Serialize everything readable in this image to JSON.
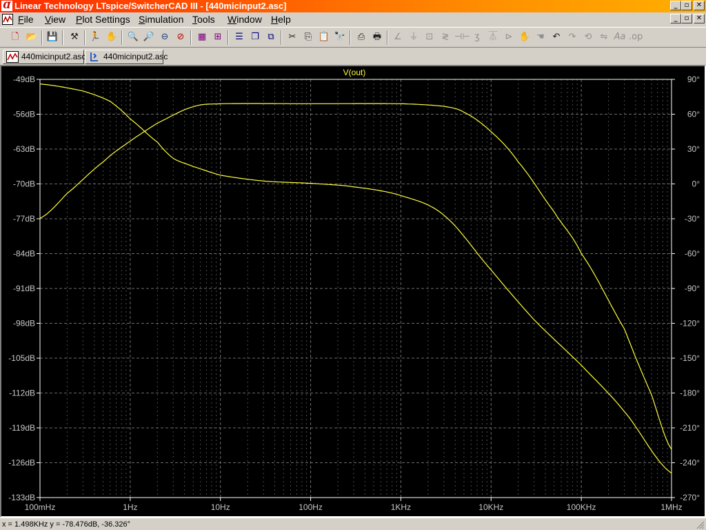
{
  "window": {
    "title": "Linear Technology LTspice/SwitcherCAD III - [440micinput2.asc]",
    "controls": [
      "_",
      "▫",
      "✕"
    ]
  },
  "menu": {
    "items": [
      {
        "label": "File",
        "accel": "F"
      },
      {
        "label": "View",
        "accel": "V"
      },
      {
        "label": "Plot Settings",
        "accel": "P"
      },
      {
        "label": "Simulation",
        "accel": "S"
      },
      {
        "label": "Tools",
        "accel": "T"
      },
      {
        "label": "Window",
        "accel": "W"
      },
      {
        "label": "Help",
        "accel": "H"
      }
    ]
  },
  "tabs": [
    {
      "label": "440micinput2.asc",
      "icon": "waveform-icon",
      "active": true
    },
    {
      "label": "440micinput2.asc",
      "icon": "schematic-icon",
      "active": false
    }
  ],
  "toolbar": {
    "icons": [
      "new-schematic-icon",
      "open-icon",
      "save-icon",
      "control-panel-icon",
      "run-icon",
      "pan-icon",
      "zoom-in-icon",
      "zoom-out-icon",
      "zoom-fit-icon",
      "zoom-cancel-icon",
      "autorange-icon",
      "grid-icon",
      "tile-horizontal-icon",
      "cascade-icon",
      "tile-vertical-icon",
      "cut-icon",
      "copy-icon",
      "paste-icon",
      "find-icon",
      "print-setup-icon",
      "print-icon",
      "wire-icon",
      "ground-icon",
      "label-icon",
      "resistor-icon",
      "capacitor-icon",
      "inductor-icon",
      "diode-icon",
      "component-icon",
      "move-icon",
      "drag-icon",
      "undo-icon",
      "redo-icon",
      "rotate-icon",
      "mirror-icon",
      "text-icon",
      "spice-directive-icon"
    ]
  },
  "plot": {
    "trace_name": "V(out)",
    "colors": {
      "background": "#000000",
      "trace": "#ffff40",
      "grid": "#808080",
      "axis": "#ffffff",
      "label": "#c8c8c8"
    }
  },
  "chart_data": {
    "type": "line",
    "title": "V(out)",
    "x_scale": "log",
    "x_ticks": [
      "100mHz",
      "1Hz",
      "10Hz",
      "100Hz",
      "1KHz",
      "10KHz",
      "100KHz",
      "1MHz"
    ],
    "xlim": [
      0.1,
      1000000
    ],
    "left_ticks": [
      "-49dB",
      "-56dB",
      "-63dB",
      "-70dB",
      "-77dB",
      "-84dB",
      "-91dB",
      "-98dB",
      "-105dB",
      "-112dB",
      "-119dB",
      "-126dB",
      "-133dB"
    ],
    "ylim": [
      -133,
      -49
    ],
    "right_ticks": [
      "90°",
      "60°",
      "30°",
      "0°",
      "-30°",
      "-60°",
      "-90°",
      "-120°",
      "-150°",
      "-180°",
      "-210°",
      "-240°",
      "-270°"
    ],
    "y2lim": [
      -270,
      90
    ],
    "grid": true,
    "series": [
      {
        "axis": "left",
        "x": [
          0.1,
          0.2,
          0.5,
          1,
          2,
          5,
          10,
          100,
          1000,
          3000,
          5000,
          10000,
          20000,
          50000,
          100000,
          300000,
          600000,
          1000000
        ],
        "y": [
          -76.9,
          -71.9,
          -65.6,
          -61.4,
          -57.8,
          -54.5,
          -53.9,
          -53.9,
          -53.9,
          -54.4,
          -55.6,
          -59.5,
          -65.6,
          -75.6,
          -84.0,
          -99.1,
          -112.3,
          -123.3
        ]
      },
      {
        "axis": "right",
        "x": [
          0.1,
          0.3,
          0.6,
          1,
          2,
          3,
          5,
          10,
          30,
          100,
          300,
          1000,
          3000,
          10000,
          30000,
          100000,
          300000,
          1000000
        ],
        "y": [
          86,
          80,
          71,
          56,
          36,
          22,
          15,
          7.5,
          2.5,
          0.5,
          -2.5,
          -10,
          -27,
          -74,
          -117,
          -156,
          -196,
          -249
        ]
      }
    ]
  },
  "status": {
    "readout": "x = 1.498KHz   y = -78.476dB, -36.326°"
  }
}
